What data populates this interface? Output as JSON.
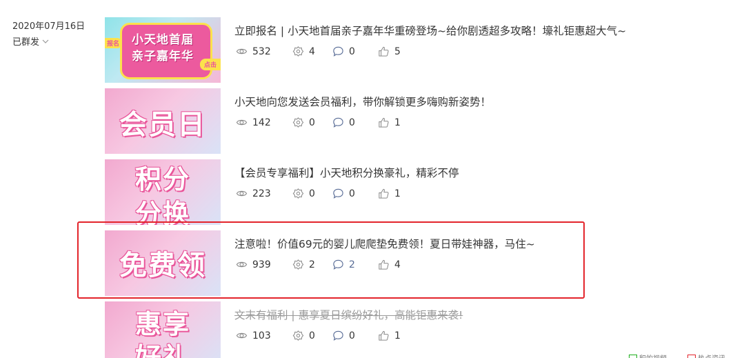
{
  "side": {
    "date": "2020年07月16日",
    "status": "已群发",
    "status_chevron_icon": "chevron-down-icon"
  },
  "articles": [
    {
      "thumb_lines": [
        "小天地首届",
        "亲子嘉年华"
      ],
      "thumb_tag_left": "报名",
      "thumb_tag_right": "点击",
      "title": "立即报名 | 小天地首届亲子嘉年华重磅登场~给你剧透超多攻略！壕礼钜惠超大气~",
      "views": "532",
      "shares": "4",
      "comments": "0",
      "likes": "5"
    },
    {
      "thumb_lines": [
        "会员日"
      ],
      "title": "小天地向您发送会员福利，带你解锁更多嗨购新姿势！",
      "views": "142",
      "shares": "0",
      "comments": "0",
      "likes": "1"
    },
    {
      "thumb_lines": [
        "积分",
        "分换"
      ],
      "title": "【会员专享福利】小天地积分换豪礼，精彩不停",
      "views": "223",
      "shares": "0",
      "comments": "0",
      "likes": "1"
    },
    {
      "thumb_lines": [
        "免费领"
      ],
      "title": "注意啦！价值69元的婴儿爬爬垫免费领！夏日带娃神器，马住~",
      "views": "939",
      "shares": "2",
      "comments": "2",
      "likes": "4"
    },
    {
      "thumb_lines": [
        "惠享",
        "好礼"
      ],
      "title": "文末有福利 | 惠享夏日缤纷好礼，高能钜惠来袭!",
      "views": "103",
      "shares": "0",
      "comments": "0",
      "likes": "1"
    }
  ],
  "bottom_bar": {
    "item1": "积的视频",
    "item2": "热点资讯"
  },
  "colors": {
    "highlight_border": "#e3242b",
    "active_comment": "#576b95",
    "thumb_pink": "#e9559a"
  },
  "icons": {
    "views": "eye-icon",
    "shares": "share-gear-icon",
    "comments": "comment-bubble-icon",
    "likes": "thumbs-up-icon"
  }
}
